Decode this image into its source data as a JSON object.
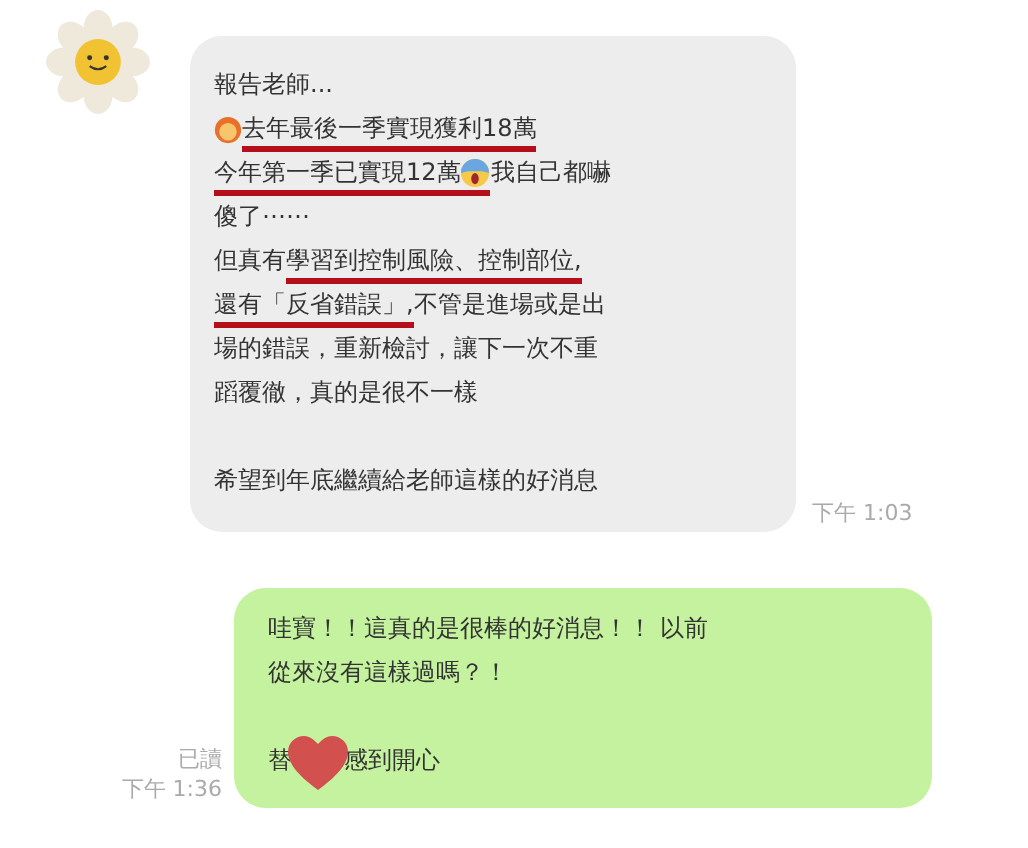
{
  "messages": [
    {
      "kind": "incoming",
      "time": "下午 1:03",
      "paragraphs": [
        [
          [
            {
              "kind": "text",
              "text": "報告老師...",
              "underlined": false
            }
          ],
          [
            {
              "kind": "person",
              "underlined": false
            },
            {
              "kind": "text",
              "text": " 去年最後一季實現獲利18萬",
              "underlined": true
            }
          ],
          [
            {
              "kind": "text",
              "text": "今年第一季已實現12萬",
              "underlined": true
            },
            {
              "kind": "scream",
              "underlined": true
            },
            {
              "kind": "text",
              "text": "我自己都嚇",
              "underlined": false
            }
          ],
          [
            {
              "kind": "text",
              "text": "傻了⋯⋯",
              "underlined": false
            }
          ],
          [
            {
              "kind": "text",
              "text": "但真有",
              "underlined": false
            },
            {
              "kind": "text",
              "text": "學習到控制風險、控制部位,",
              "underlined": true
            }
          ],
          [
            {
              "kind": "text",
              "text": "還有「反省錯誤」,",
              "underlined": true
            },
            {
              "kind": "text",
              "text": " 不管是進場或是出",
              "underlined": false
            }
          ],
          [
            {
              "kind": "text",
              "text": "場的錯誤，重新檢討，讓下一次不重",
              "underlined": false
            }
          ],
          [
            {
              "kind": "text",
              "text": "蹈覆徹，真的是很不一樣",
              "underlined": false
            }
          ]
        ],
        [
          [
            {
              "kind": "text",
              "text": "希望到年底繼續給老師這樣的好消息",
              "underlined": false
            }
          ]
        ]
      ]
    },
    {
      "kind": "outgoing",
      "read": "已讀",
      "time": "下午 1:36",
      "paragraphs": [
        [
          [
            {
              "kind": "text",
              "text": "哇寶！！這真的是很棒的好消息！！ 以前",
              "underlined": false
            }
          ],
          [
            {
              "kind": "text",
              "text": "從來沒有這樣過嗎？！",
              "underlined": false
            }
          ]
        ],
        [
          [
            {
              "kind": "text",
              "text": "替",
              "underlined": false
            },
            {
              "kind": "heart"
            },
            {
              "kind": "text",
              "text": "感到開心",
              "underlined": false
            }
          ]
        ]
      ]
    }
  ]
}
